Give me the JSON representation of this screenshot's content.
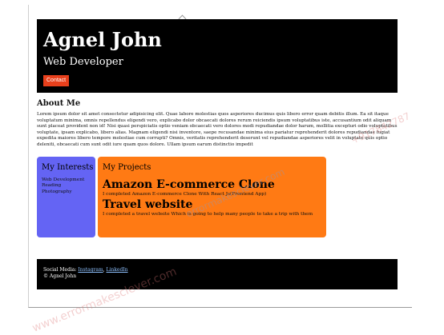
{
  "header": {
    "name": "Agnel John",
    "title": "Web Developer",
    "contact_label": "Contact"
  },
  "about": {
    "heading": "About Me",
    "text": "Lorem ipsum dolor sit amet consectetur adipisicing elit. Quae labore molestias quos asperiores ducimus quis libero error quam debitis illum. Ea sit itaque voluptatum minima, omnis repellendus eligendi vero, explicabo dolor obcaecati dolores rerum reiciendis ipsum voluptatibus iste, accusantium odit aliquam sunt placeat provident non id! Nisi quasi perspiciatis optio veniam obcaecati vero dolores modi repudiandae dolor harum, mollitia excepturi odio voluptatibus voluptate, ipsam explicabo, libero alias. Magnam eligendi nisi inventore, saepe recusandae minima eius pariatur reprehenderit dolores repudiandae fugiat expedita maiores libero tempore molestiae cum corrupti? Omnis, veritatis reprehenderit deserunt vel repudiandae asperiores velit in voluptate quis optio deleniti, obcaecati cum sunt odit iure quam quos dolore. Ullam ipsum earum distinctio impedit"
  },
  "interests": {
    "heading": "My Interests",
    "items": [
      "Web Development",
      "Reading",
      "Photography"
    ]
  },
  "projects": {
    "heading": "My Projects",
    "items": [
      {
        "title": "Amazon E-commerce Clone",
        "description": "I completed Amazon E-commerce Clone With React Js(Frontend App)"
      },
      {
        "title": "Travel website",
        "description": "I completed a travel website Which is going to help many people to take a trip with them"
      }
    ]
  },
  "footer": {
    "social_label": "Social Media:",
    "instagram": "Instagram",
    "separator": ",",
    "linkedin": "LinkedIn",
    "copyright": "© Agnel John"
  },
  "watermarks": {
    "wm1": "www.errormakesclever.com",
    "wm2": "errormakesclever.com",
    "wm3": "+917842787"
  },
  "colors": {
    "header_bg": "#000000",
    "contact_button": "#e8401c",
    "interests_card": "#6464f4",
    "projects_card": "#ff7a14",
    "footer_link": "#8fc2ff"
  }
}
